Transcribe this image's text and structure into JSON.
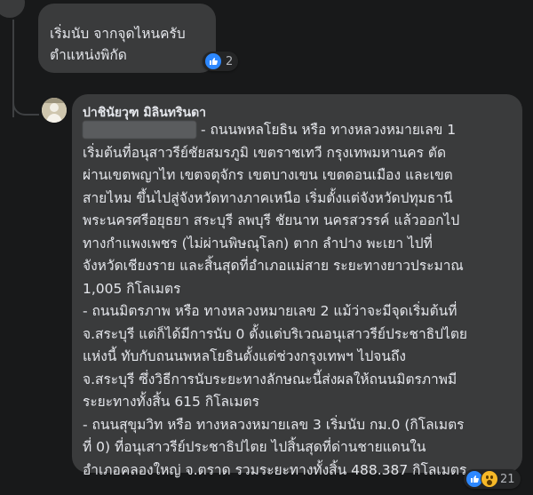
{
  "comment1": {
    "text": "เริ่มนับ จากจุดไหนครับ\nตำแหน่งพิกัด",
    "reactions": {
      "icons": [
        "like-icon"
      ],
      "count": "2"
    }
  },
  "comment2": {
    "author": "ปาชินัยวุฑ มิลินทรินดา",
    "body": "                           - ถนนพหลโยธิน หรือ ทางหลวงหมายเลข 1\nเริ่มต้นที่อนุสาวรีย์ชัยสมรภูมิ เขตราชเทวี กรุงเทพมหานคร ตัด\nผ่านเขตพญาไท เขตจตุจักร เขตบางเขน เขตดอนเมือง และเขต\nสายไหม ขึ้นไปสู่จังหวัดทางภาคเหนือ เริ่มตั้งแต่จังหวัดปทุมธานี\nพระนครศรีอยุธยา สระบุรี ลพบุรี ชัยนาท นครสวรรค์ แล้วออกไป\nทางกำแพงเพชร (ไม่ผ่านพิษณุโลก) ตาก ลำปาง พะเยา ไปที่\nจังหวัดเชียงราย และสิ้นสุดที่อำเภอแม่สาย ระยะทางยาวประมาณ\n1,005 กิโลเมตร\n- ถนนมิตรภาพ หรือ ทางหลวงหมายเลข 2 แม้ว่าจะมีจุดเริ่มต้นที่\nจ.สระบุรี แต่ก็ได้มีการนับ 0 ตั้งแต่บริเวณอนุเสาวรีย์ประชาธิปไตย\nแห่งนี้ ทับกับถนนพหลโยธินตั้งแต่ช่วงกรุงเทพฯ ไปจนถึง\nจ.สระบุรี ซึ่งวิธีการนับระยะทางลักษณะนี้ส่งผลให้ถนนมิตรภาพมี\nระยะทางทั้งสิ้น 615 กิโลเมตร\n- ถนนสุขุมวิท หรือ ทางหลวงหมายเลข 3 เริ่มนับ กม.0 (กิโลเมตร\nที่ 0) ที่อนุเสาวรีย์ประชาธิปไตย ไปสิ้นสุดที่ด่านชายแดนใน\nอำเภอคลองใหญ่ จ.ตราด รวมระยะทางทั้งสิ้น 488.387 กิโลเมตร",
    "reactions": {
      "icons": [
        "like-icon",
        "wow-icon"
      ],
      "count": "21"
    }
  },
  "colors": {
    "background": "#18191a",
    "bubble": "#3a3b3c",
    "text": "#e4e6eb",
    "like": "#2d88ff",
    "wow": "#f7b928"
  }
}
